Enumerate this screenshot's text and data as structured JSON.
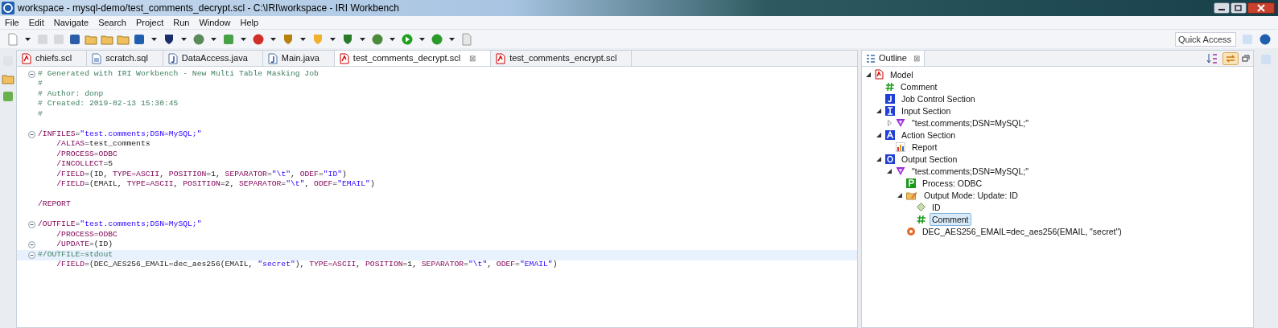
{
  "window": {
    "title": "workspace - mysql-demo/test_comments_decrypt.scl - C:\\IRI\\workspace - IRI Workbench"
  },
  "menu": [
    "File",
    "Edit",
    "Navigate",
    "Search",
    "Project",
    "Run",
    "Window",
    "Help"
  ],
  "quick_access": {
    "placeholder": "Quick Access"
  },
  "editor_tabs": [
    {
      "label": "chiefs.scl",
      "kind": "scl",
      "selected": false
    },
    {
      "label": "scratch.sql",
      "kind": "sql",
      "selected": false
    },
    {
      "label": "DataAccess.java",
      "kind": "java",
      "selected": false
    },
    {
      "label": "Main.java",
      "kind": "java",
      "selected": false
    },
    {
      "label": "test_comments_decrypt.scl",
      "kind": "scl",
      "selected": true,
      "close": "⊠"
    },
    {
      "label": "test_comments_encrypt.scl",
      "kind": "scl",
      "selected": false
    }
  ],
  "code_lines": [
    {
      "fold": true,
      "current": false,
      "tokens": [
        {
          "kind": "comment",
          "text": "# Generated with IRI Workbench - New Multi Table Masking Job"
        }
      ]
    },
    {
      "fold": false,
      "current": false,
      "tokens": [
        {
          "kind": "comment",
          "text": "#"
        }
      ]
    },
    {
      "fold": false,
      "current": false,
      "tokens": [
        {
          "kind": "comment",
          "text": "# Author: donp"
        }
      ]
    },
    {
      "fold": false,
      "current": false,
      "tokens": [
        {
          "kind": "comment",
          "text": "# Created: 2019-02-13 15:30:45"
        }
      ]
    },
    {
      "fold": false,
      "current": false,
      "tokens": [
        {
          "kind": "comment",
          "text": "#"
        }
      ]
    },
    {
      "fold": false,
      "current": false
    },
    {
      "fold": true,
      "current": false,
      "tokens": [
        {
          "kind": "keyword",
          "text": "/INFILES"
        },
        {
          "kind": "plain",
          "text": "="
        },
        {
          "kind": "string",
          "text": "\"test.comments;DSN=MySQL;\""
        }
      ]
    },
    {
      "fold": false,
      "current": false,
      "tokens": [
        {
          "kind": "keyword",
          "text": "    /ALIAS"
        },
        {
          "kind": "plain",
          "text": "=test_comments"
        }
      ]
    },
    {
      "fold": false,
      "current": false,
      "tokens": [
        {
          "kind": "keyword",
          "text": "    /PROCESS=ODBC"
        }
      ]
    },
    {
      "fold": false,
      "current": false,
      "tokens": [
        {
          "kind": "keyword",
          "text": "    /INCOLLECT"
        },
        {
          "kind": "plain",
          "text": "=5"
        }
      ]
    },
    {
      "fold": false,
      "current": false,
      "tokens": [
        {
          "kind": "keyword",
          "text": "    /FIELD"
        },
        {
          "kind": "plain",
          "text": "=(ID, "
        },
        {
          "kind": "keyword",
          "text": "TYPE=ASCII"
        },
        {
          "kind": "plain",
          "text": ", "
        },
        {
          "kind": "keyword",
          "text": "POSITION"
        },
        {
          "kind": "plain",
          "text": "=1, "
        },
        {
          "kind": "keyword",
          "text": "SEPARATOR"
        },
        {
          "kind": "plain",
          "text": "="
        },
        {
          "kind": "string",
          "text": "\"\\t\""
        },
        {
          "kind": "plain",
          "text": ", "
        },
        {
          "kind": "keyword",
          "text": "ODEF"
        },
        {
          "kind": "plain",
          "text": "="
        },
        {
          "kind": "string",
          "text": "\"ID\""
        },
        {
          "kind": "plain",
          "text": ")"
        }
      ]
    },
    {
      "fold": false,
      "current": false,
      "tokens": [
        {
          "kind": "keyword",
          "text": "    /FIELD"
        },
        {
          "kind": "plain",
          "text": "=(EMAIL, "
        },
        {
          "kind": "keyword",
          "text": "TYPE=ASCII"
        },
        {
          "kind": "plain",
          "text": ", "
        },
        {
          "kind": "keyword",
          "text": "POSITION"
        },
        {
          "kind": "plain",
          "text": "=2, "
        },
        {
          "kind": "keyword",
          "text": "SEPARATOR"
        },
        {
          "kind": "plain",
          "text": "="
        },
        {
          "kind": "string",
          "text": "\"\\t\""
        },
        {
          "kind": "plain",
          "text": ", "
        },
        {
          "kind": "keyword",
          "text": "ODEF"
        },
        {
          "kind": "plain",
          "text": "="
        },
        {
          "kind": "string",
          "text": "\"EMAIL\""
        },
        {
          "kind": "plain",
          "text": ")"
        }
      ]
    },
    {
      "fold": false,
      "current": false
    },
    {
      "fold": false,
      "current": false,
      "tokens": [
        {
          "kind": "keyword",
          "text": "/REPORT"
        }
      ]
    },
    {
      "fold": false,
      "current": false
    },
    {
      "fold": true,
      "current": false,
      "tokens": [
        {
          "kind": "keyword",
          "text": "/OUTFILE"
        },
        {
          "kind": "plain",
          "text": "="
        },
        {
          "kind": "string",
          "text": "\"test.comments;DSN=MySQL;\""
        }
      ]
    },
    {
      "fold": false,
      "current": false,
      "tokens": [
        {
          "kind": "keyword",
          "text": "    /PROCESS=ODBC"
        }
      ]
    },
    {
      "fold": true,
      "current": false,
      "tokens": [
        {
          "kind": "keyword",
          "text": "    /UPDATE"
        },
        {
          "kind": "plain",
          "text": "=(ID)"
        }
      ]
    },
    {
      "fold": true,
      "current": true,
      "tokens": [
        {
          "kind": "comment",
          "text": "#/OUTFILE=stdout"
        }
      ]
    },
    {
      "fold": false,
      "current": false,
      "tokens": [
        {
          "kind": "keyword",
          "text": "    /FIELD"
        },
        {
          "kind": "plain",
          "text": "=(DEC_AES256_EMAIL=dec_aes256(EMAIL, "
        },
        {
          "kind": "string",
          "text": "\"secret\""
        },
        {
          "kind": "plain",
          "text": "), "
        },
        {
          "kind": "keyword",
          "text": "TYPE=ASCII"
        },
        {
          "kind": "plain",
          "text": ", "
        },
        {
          "kind": "keyword",
          "text": "POSITION"
        },
        {
          "kind": "plain",
          "text": "=1, "
        },
        {
          "kind": "keyword",
          "text": "SEPARATOR"
        },
        {
          "kind": "plain",
          "text": "="
        },
        {
          "kind": "string",
          "text": "\"\\t\""
        },
        {
          "kind": "plain",
          "text": ", "
        },
        {
          "kind": "keyword",
          "text": "ODEF"
        },
        {
          "kind": "plain",
          "text": "="
        },
        {
          "kind": "string",
          "text": "\"EMAIL\""
        },
        {
          "kind": "plain",
          "text": ")"
        }
      ]
    }
  ],
  "outline": {
    "title": "Outline",
    "close": "⊠",
    "tree": [
      {
        "label": "Model",
        "kind": "model",
        "expanded": true,
        "selected": false,
        "children": [
          {
            "label": "Comment",
            "kind": "comment",
            "selected": false
          },
          {
            "label": "Job Control Section",
            "kind": "job",
            "selected": false
          },
          {
            "label": "Input Section",
            "kind": "input",
            "expanded": true,
            "selected": false,
            "children": [
              {
                "label": "\"test.comments;DSN=MySQL;\"",
                "kind": "source",
                "expanded": false,
                "selected": false
              }
            ]
          },
          {
            "label": "Action Section",
            "kind": "action",
            "expanded": true,
            "selected": false,
            "children": [
              {
                "label": "Report",
                "kind": "report",
                "selected": false
              }
            ]
          },
          {
            "label": "Output Section",
            "kind": "output",
            "expanded": true,
            "selected": false,
            "children": [
              {
                "label": "\"test.comments;DSN=MySQL;\"",
                "kind": "source",
                "expanded": true,
                "selected": false,
                "children": [
                  {
                    "label": "Process: ODBC",
                    "kind": "process",
                    "selected": false
                  },
                  {
                    "label": "Output Mode: Update: ID",
                    "kind": "mode",
                    "expanded": true,
                    "selected": false,
                    "children": [
                      {
                        "label": "ID",
                        "kind": "field",
                        "selected": false
                      },
                      {
                        "label": "Comment",
                        "kind": "comment",
                        "selected": true
                      }
                    ]
                  },
                  {
                    "label": "DEC_AES256_EMAIL=dec_aes256(EMAIL, \"secret\")",
                    "kind": "function",
                    "selected": false
                  }
                ]
              }
            ]
          }
        ]
      }
    ]
  }
}
